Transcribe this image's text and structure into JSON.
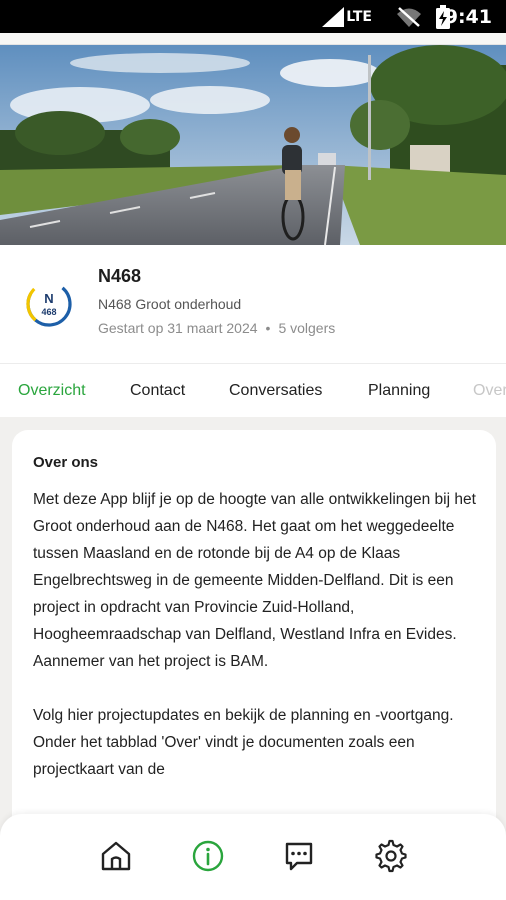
{
  "status": {
    "network": "LTE",
    "time": "9:41"
  },
  "project": {
    "logo_text": "N 468",
    "title": "N468",
    "subtitle": "N468 Groot onderhoud",
    "started": "Gestart op 31 maart 2024",
    "separator": "•",
    "followers": "5 volgers"
  },
  "tabs": [
    {
      "label": "Overzicht",
      "active": true
    },
    {
      "label": "Contact"
    },
    {
      "label": "Conversaties"
    },
    {
      "label": "Planning"
    },
    {
      "label": "Over"
    }
  ],
  "about": {
    "heading": "Over ons",
    "paragraphs": [
      "Met deze App blijf je op de hoogte van alle ontwikkelingen bij het Groot onderhoud aan de N468. Het gaat om het weggedeelte tussen Maasland en de rotonde bij de A4 op de Klaas Engelbrechtsweg in de gemeente Midden-Delfland. Dit is een project in opdracht van Provincie Zuid-Holland, Hoogheemraadschap van Delfland, Westland Infra en Evides. Aannemer van het project is BAM.",
      "Volg hier projectupdates en bekijk de planning en -voortgang. Onder het tabblad 'Over' vindt je documenten zoals een projectkaart van de"
    ]
  },
  "nav": [
    {
      "icon": "home-icon"
    },
    {
      "icon": "info-icon",
      "active": true
    },
    {
      "icon": "chat-icon"
    },
    {
      "icon": "settings-icon"
    }
  ],
  "colors": {
    "accent": "#2aa53d",
    "logo_blue": "#1d5fa8",
    "logo_yellow": "#f2c500"
  }
}
